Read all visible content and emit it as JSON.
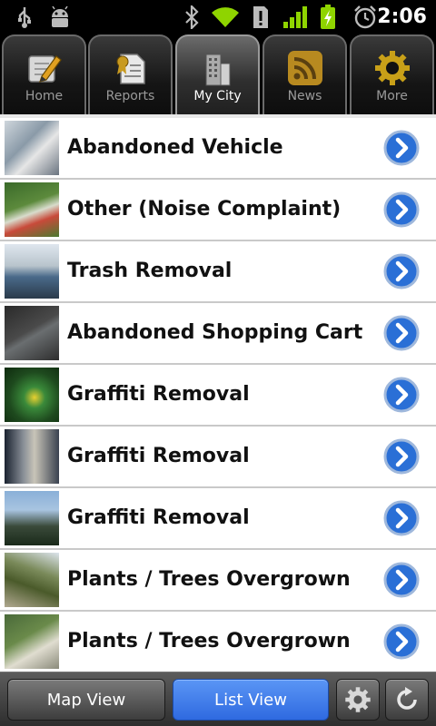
{
  "status_bar": {
    "time": "2:06",
    "icons": [
      "usb-icon",
      "android-debug-icon",
      "bluetooth-icon",
      "wifi-icon",
      "alert-icon",
      "signal-icon",
      "battery-charging-icon",
      "alarm-icon"
    ]
  },
  "tabs": [
    {
      "label": "Home",
      "icon": "home-icon",
      "active": false
    },
    {
      "label": "Reports",
      "icon": "reports-icon",
      "active": false
    },
    {
      "label": "My City",
      "icon": "city-icon",
      "active": true
    },
    {
      "label": "News",
      "icon": "rss-icon",
      "active": false
    },
    {
      "label": "More",
      "icon": "gear-icon",
      "active": false
    }
  ],
  "list": {
    "items": [
      {
        "label": "Abandoned Vehicle"
      },
      {
        "label": "Other (Noise Complaint)"
      },
      {
        "label": "Trash Removal"
      },
      {
        "label": "Abandoned Shopping Cart"
      },
      {
        "label": "Graffiti Removal"
      },
      {
        "label": "Graffiti Removal"
      },
      {
        "label": "Graffiti Removal"
      },
      {
        "label": "Plants / Trees Overgrown"
      },
      {
        "label": "Plants / Trees Overgrown"
      }
    ]
  },
  "bottom_bar": {
    "map_view_label": "Map View",
    "list_view_label": "List View",
    "active_view": "List View"
  },
  "colors": {
    "accent_blue": "#2f6ae0",
    "chevron_blue": "#2a6fd6"
  }
}
